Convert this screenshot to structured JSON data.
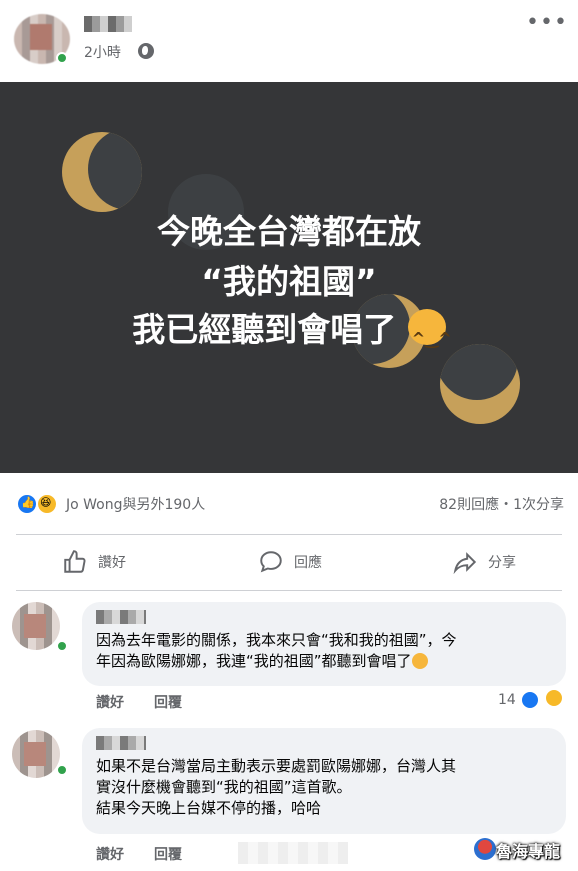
{
  "post": {
    "time": "2小時",
    "audience_icon": "globe-icon",
    "more_icon": "more-options-icon",
    "image": {
      "lines": [
        "今晚全台灣都在放",
        "“我的祖國”",
        "我已經聽到會唱了"
      ],
      "emoji": "grinning-cat-emoji"
    },
    "reactions": {
      "names": "Jo Wong與另外190人",
      "stats": "82則回應・1次分享"
    },
    "actions": {
      "like": "讚好",
      "comment": "回應",
      "share": "分享"
    }
  },
  "comments": [
    {
      "text_line1": "因為去年電影的關係，我本來只會“我和我的祖國”，今",
      "text_line2": "年因為歐陽娜娜，我連“我的祖國”都聽到會唱了",
      "like_label": "讚好",
      "reply_label": "回覆",
      "reaction_count": "14"
    },
    {
      "text_line1": "如果不是台灣當局主動表示要處罰歐陽娜娜，台灣人其",
      "text_line2": "實沒什麼機會聽到“我的祖國”這首歌。",
      "text_line3": "結果今天晚上台媒不停的播，哈哈",
      "like_label": "讚好",
      "reply_label": "回覆"
    }
  ],
  "watermark": "魯海專龍",
  "colors": {
    "image_bg": "#353638",
    "moon": "#c6a05a",
    "like_blue": "#1877f2",
    "online_green": "#31a24c"
  }
}
